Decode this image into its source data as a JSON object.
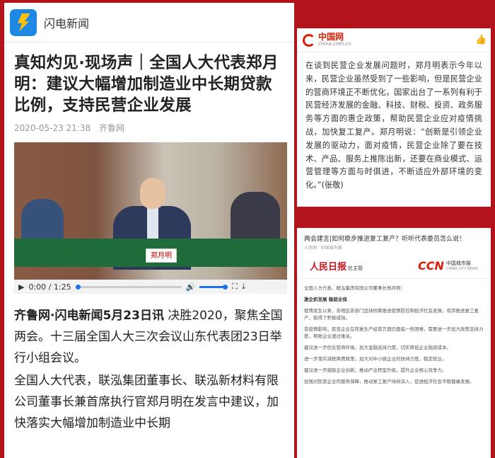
{
  "left": {
    "app_name": "闪电新闻",
    "headline": "真知灼见·现场声｜全国人大代表郑月明：建议大幅增加制造业中长期贷款比例，支持民营企业发展",
    "date": "2020-05-23 21:38",
    "source": "齐鲁网",
    "video": {
      "nameplate": "郑月明",
      "time": "0:00 / 1:25",
      "play_icon": "play-icon"
    },
    "body_lead": "齐鲁网·闪电新闻5月23日讯",
    "body_p1": "决胜2020，聚焦全国两会。十三届全国人大三次会议山东代表团23日举行小组会议。",
    "body_p2": "全国人大代表，联泓集团董事长、联泓新材料有限公司董事长兼首席执行官郑月明在发言中建议，加快落实大幅增加制造业中长期"
  },
  "right_top": {
    "logo_cn": "中国网",
    "logo_en": "china.com.cn",
    "text": "在谈到民营企业发展问题时，郑月明表示今年以来，民营企业虽然受到了一些影响，但是民营企业的营商环境正不断优化，国家出台了一系列有利于民营经济发展的金融、科技、财税、投资、政务服务等方面的惠企政策，帮助民营企业应对疫情挑战，加快复工复产。郑月明说：“创新是引领企业发展的驱动力，面对疫情，民营企业除了要在技术、产品、服务上推陈出新，还要在商业模式、运营管理等方面与时俱进，不断适应外部环境的变化。”(张敬)"
  },
  "right_bottom": {
    "title": "两会建言|如何稳步推进复工复产？听听代表委员怎么说！",
    "sub": "人民网 · 中国城市报",
    "logo1": "人民日报",
    "logo1_sub": "社主管",
    "logo2": "CCN",
    "logo2_sub": "中国城市报",
    "logo2_en": "CHINA CITY NEWS",
    "intro": "全国人大代表、联泓集团有限公司董事长郑月明：",
    "bold_line": "激企抓发展  稳就业保",
    "paras": [
      "疫情发生以来，各地区各部门坚持统筹推进疫情防控和经济社会发展，有序推进复工复产，取得了积极成效。",
      "受疫情影响，民营企业在恢复生产经营方面仍面临一些困难，需要进一步加大政策支持力度，帮助企业渡过难关。",
      "建议进一步优化营商环境，加大金融支持力度，切实降低企业融资成本。",
      "进一步落实减税降费政策，加大对中小微企业的扶持力度，稳定就业。",
      "建议进一步鼓励企业创新，推动产业转型升级，提升企业核心竞争力。",
      "加强对民营企业的服务保障，推动复工复产持续深入，促进经济社会平稳健康发展。"
    ]
  }
}
